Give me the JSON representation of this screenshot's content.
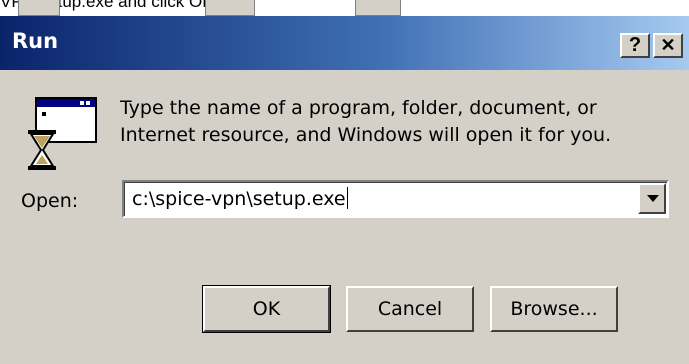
{
  "page_caption": "VPN\\setup.exe and click OK.",
  "dialog": {
    "title": "Run",
    "help_button": "?",
    "close_button": "✕",
    "instruction_line1": "Type the name of a program, folder, document, or",
    "instruction_line2": "Internet resource, and Windows will open it for you.",
    "open_label": "Open:",
    "open_value": "c:\\spice-vpn\\setup.exe",
    "buttons": {
      "ok": "OK",
      "cancel": "Cancel",
      "browse": "Browse..."
    }
  },
  "colors": {
    "titlebar_start": "#0a246a",
    "titlebar_end": "#a6caf0",
    "dialog_face": "#d4d0c8"
  },
  "icons": [
    "run-program-icon",
    "dropdown-arrow-icon"
  ]
}
